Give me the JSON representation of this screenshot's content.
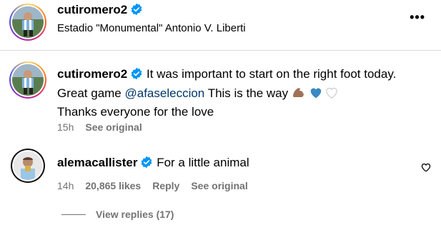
{
  "post": {
    "username": "cutiromero2",
    "location": "Estadio \"Monumental\" Antonio V. Liberti",
    "more": "•••"
  },
  "caption": {
    "username": "cutiromero2",
    "text_part1": "It was important to start on the right foot today.",
    "text_part2": "Great game",
    "mention": "@afaseleccion",
    "text_part3": "This is the way",
    "text_line3": "Thanks everyone for the love",
    "time": "15h",
    "see_original": "See original"
  },
  "comment": {
    "username": "alemacallister",
    "text": "For a little animal",
    "time": "14h",
    "likes": "20,865 likes",
    "reply": "Reply",
    "see_original": "See original"
  },
  "replies": {
    "label": "View replies (17)"
  },
  "colors": {
    "verified": "#0095f6",
    "muted": "#737373",
    "mention": "#00376b"
  }
}
